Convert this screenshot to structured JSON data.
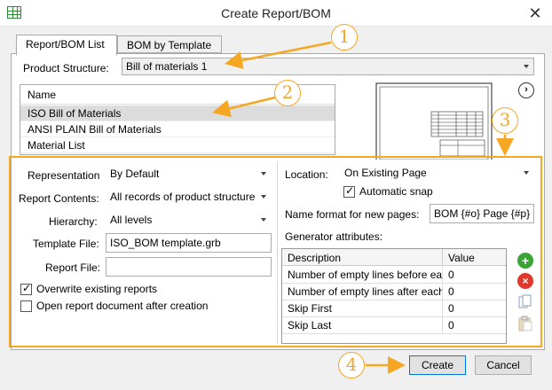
{
  "window": {
    "title": "Create Report/BOM",
    "close": "✕"
  },
  "tabs": [
    {
      "label": "Report/BOM List"
    },
    {
      "label": "BOM by Template"
    }
  ],
  "product_structure": {
    "label": "Product Structure:",
    "value": "Bill of materials 1"
  },
  "list": {
    "header": "Name",
    "items": [
      "ISO Bill of Materials",
      "ANSI PLAIN Bill of Materials",
      "Material List"
    ]
  },
  "nav_arrow": "›",
  "form": {
    "representation": {
      "label": "Representation",
      "value": "By Default"
    },
    "report_contents": {
      "label": "Report Contents:",
      "value": "All records of product structure"
    },
    "hierarchy": {
      "label": "Hierarchy:",
      "value": "All levels"
    },
    "template_file": {
      "label": "Template File:",
      "value": "ISO_BOM template.grb"
    },
    "report_file": {
      "label": "Report File:",
      "value": ""
    },
    "overwrite": {
      "label": "Overwrite existing reports",
      "checked": true
    },
    "open_after": {
      "label": "Open report document after creation",
      "checked": false
    }
  },
  "right": {
    "location": {
      "label": "Location:",
      "value": "On Existing Page"
    },
    "automatic_snap": {
      "label": "Automatic snap",
      "checked": true
    },
    "name_format": {
      "label": "Name format for new pages:",
      "value": "BOM {#o} Page {#p}"
    },
    "generator": {
      "label": "Generator attributes:"
    }
  },
  "grid": {
    "columns": [
      "Description",
      "Value"
    ],
    "rows": [
      {
        "description": "Number of empty lines before each",
        "value": "0"
      },
      {
        "description": "Number of empty lines after each",
        "value": "0"
      },
      {
        "description": "Skip First",
        "value": "0"
      },
      {
        "description": "Skip Last",
        "value": "0"
      }
    ]
  },
  "buttons": {
    "create": "Create",
    "cancel": "Cancel"
  },
  "callouts": [
    "1",
    "2",
    "3",
    "4"
  ],
  "colors": {
    "accent": "#f5a623",
    "add": "#3aa335",
    "delete": "#e0382d",
    "default_border": "#0078d7"
  }
}
